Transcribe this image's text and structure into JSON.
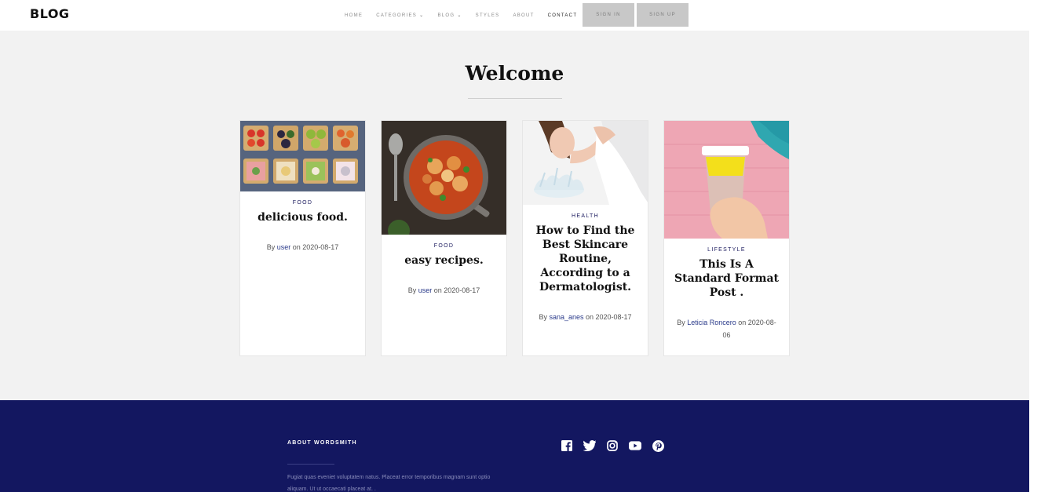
{
  "header": {
    "logo": "BLOG",
    "nav": [
      {
        "label": "HOME",
        "dropdown": false,
        "active": false
      },
      {
        "label": "CATEGORIES",
        "dropdown": true,
        "active": false
      },
      {
        "label": "BLOG",
        "dropdown": true,
        "active": false
      },
      {
        "label": "STYLES",
        "dropdown": false,
        "active": false
      },
      {
        "label": "ABOUT",
        "dropdown": false,
        "active": false
      },
      {
        "label": "CONTACT",
        "dropdown": false,
        "active": true
      }
    ],
    "sign_in": "SIGN IN",
    "sign_up": "SIGN UP"
  },
  "main": {
    "heading": "Welcome",
    "posts": [
      {
        "category": "FOOD",
        "title": "delicious food.",
        "by": "By ",
        "author": "user",
        "on": " on 2020-08-17",
        "image": "toast-platter-photo"
      },
      {
        "category": "FOOD",
        "title": "easy recipes.",
        "by": "By ",
        "author": "user",
        "on": " on 2020-08-17",
        "image": "stew-pot-photo"
      },
      {
        "category": "HEALTH",
        "title": "How to Find the Best Skincare Routine, According to a Dermatologist.",
        "by": "By ",
        "author": "sana_anes",
        "on": " on 2020-08-17",
        "image": "face-washing-photo"
      },
      {
        "category": "LIFESTYLE",
        "title": "This Is A Standard Format Post .",
        "by": "By ",
        "author": "Leticia Roncero",
        "on": " on 2020-08-06",
        "image": "coffee-cup-photo"
      }
    ]
  },
  "footer": {
    "about_title": "ABOUT WORDSMITH",
    "about_text": "Fugiat quas eveniet voluptatem natus. Placeat error temporibus magnam sunt optio aliquam. Ut ut occaecati placeat at. .",
    "social": [
      "facebook-icon",
      "twitter-icon",
      "instagram-icon",
      "youtube-icon",
      "pinterest-icon"
    ]
  },
  "colors": {
    "footer_bg": "#131760",
    "main_bg": "#f2f2f2",
    "category": "#1b1a5e",
    "button_bg": "#c8c8c8"
  }
}
